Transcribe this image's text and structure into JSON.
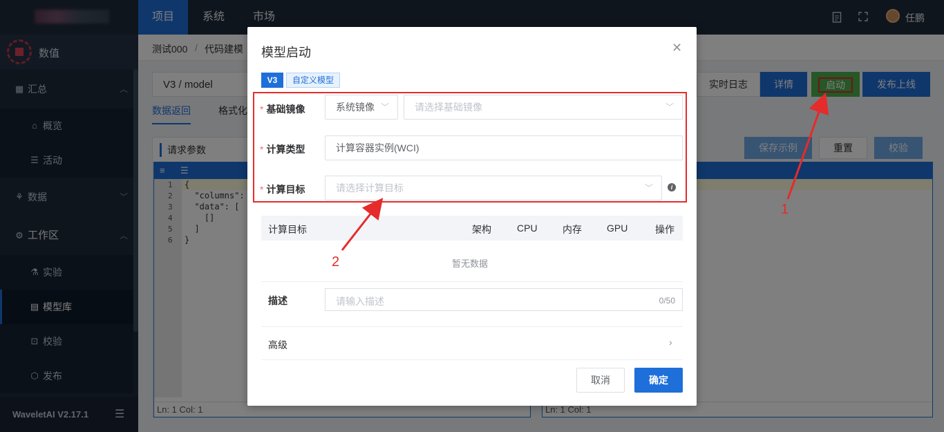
{
  "topnav": {
    "items": [
      "项目",
      "系统",
      "市场"
    ],
    "user_name": "任鹏"
  },
  "sidebar": {
    "brand": "数值",
    "items": [
      {
        "label": "汇总",
        "icon": "grid-icon"
      },
      {
        "label": "概览",
        "icon": "home-icon"
      },
      {
        "label": "活动",
        "icon": "list-icon"
      },
      {
        "label": "数据",
        "icon": "tree-icon"
      },
      {
        "label": "工作区",
        "icon": "gear-icon"
      },
      {
        "label": "实验",
        "icon": "flask-icon"
      },
      {
        "label": "模型库",
        "icon": "database-icon"
      },
      {
        "label": "校验",
        "icon": "scan-icon"
      },
      {
        "label": "发布",
        "icon": "cube-icon"
      }
    ],
    "version": "WaveletAI V2.17.1"
  },
  "background": {
    "breadcrumb": [
      "测试000",
      "代码建模"
    ],
    "model_path": "V3 / model",
    "buttons": {
      "realtime_log": "实时日志",
      "details": "详情",
      "launch": "启动",
      "publish": "发布上线",
      "save_example": "保存示例",
      "reset": "重置",
      "verify": "校验"
    },
    "tabs": [
      "数据返回",
      "格式化"
    ],
    "request_title": "请求参数",
    "code_lines": [
      "{",
      "  \"columns\":",
      "  \"data\": [",
      "    []",
      "  ]",
      "}"
    ],
    "status_left": "Ln: 1   Col: 1",
    "status_right": "Ln: 1   Col: 1"
  },
  "dialog": {
    "title": "模型启动",
    "tags": [
      "V3",
      "自定义模型"
    ],
    "fields": {
      "base_image_label": "基础镜像",
      "base_image_type": "系统镜像",
      "base_image_placeholder": "请选择基础镜像",
      "compute_type_label": "计算类型",
      "compute_type_value": "计算容器实例(WCI)",
      "compute_target_label": "计算目标",
      "compute_target_placeholder": "请选择计算目标"
    },
    "table": {
      "columns": [
        "计算目标",
        "架构",
        "CPU",
        "内存",
        "GPU",
        "操作"
      ],
      "empty": "暂无数据"
    },
    "description_label": "描述",
    "description_placeholder": "请输入描述",
    "description_counter": "0/50",
    "advanced_label": "高级",
    "cancel": "取消",
    "confirm": "确定"
  },
  "annotations": [
    "1",
    "2"
  ],
  "colors": {
    "accent": "#1e6fd9",
    "annotation": "#e52b2b",
    "nav_bg": "#1e2a3b",
    "launch_green": "#4cae4c"
  }
}
